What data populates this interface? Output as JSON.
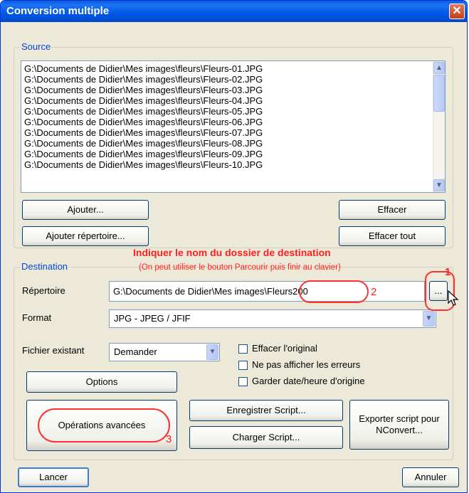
{
  "window": {
    "title": "Conversion multiple",
    "close_glyph": "✕"
  },
  "source": {
    "legend": "Source",
    "files": [
      "G:\\Documents de Didier\\Mes images\\fleurs\\Fleurs-01.JPG",
      "G:\\Documents de Didier\\Mes images\\fleurs\\Fleurs-02.JPG",
      "G:\\Documents de Didier\\Mes images\\fleurs\\Fleurs-03.JPG",
      "G:\\Documents de Didier\\Mes images\\fleurs\\Fleurs-04.JPG",
      "G:\\Documents de Didier\\Mes images\\fleurs\\Fleurs-05.JPG",
      "G:\\Documents de Didier\\Mes images\\fleurs\\Fleurs-06.JPG",
      "G:\\Documents de Didier\\Mes images\\fleurs\\Fleurs-07.JPG",
      "G:\\Documents de Didier\\Mes images\\fleurs\\Fleurs-08.JPG",
      "G:\\Documents de Didier\\Mes images\\fleurs\\Fleurs-09.JPG",
      "G:\\Documents de Didier\\Mes images\\fleurs\\Fleurs-10.JPG"
    ],
    "add_label": "Ajouter...",
    "clear_label": "Effacer",
    "add_folder_label": "Ajouter répertoire...",
    "clear_all_label": "Effacer tout"
  },
  "annotations": {
    "heading": "Indiquer le nom du dossier de destination",
    "subheading": "(On peut utiliser le bouton Parcourir puis finir au clavier)",
    "num1": "1",
    "num2": "2",
    "num3": "3"
  },
  "destination": {
    "legend": "Destination",
    "folder_label": "Répertoire",
    "folder_value": "G:\\Documents de Didier\\Mes images\\Fleurs200",
    "browse_label": "...",
    "format_label": "Format",
    "format_value": "JPG - JPEG / JFIF",
    "existing_label": "Fichier existant",
    "existing_value": "Demander",
    "delete_original_label": "Effacer l'original",
    "no_errors_label": "Ne pas afficher les erreurs",
    "keep_date_label": "Garder date/heure d'origine",
    "options_label": "Options",
    "advanced_label": "Opérations avancées",
    "save_script_label": "Enregistrer Script...",
    "load_script_label": "Charger Script...",
    "export_line1": "Exporter script pour",
    "export_line2": "NConvert..."
  },
  "footer": {
    "run_label": "Lancer",
    "cancel_label": "Annuler"
  },
  "icons": {
    "scroll_up": "▲",
    "scroll_down": "▼",
    "dropdown": "▼",
    "pointer": "mouse-pointer-icon"
  },
  "colors": {
    "title_bar": "#0058e6",
    "legend_text": "#0046d5",
    "annotation_red": "#ff2020",
    "dialog_bg": "#ece9d8"
  }
}
